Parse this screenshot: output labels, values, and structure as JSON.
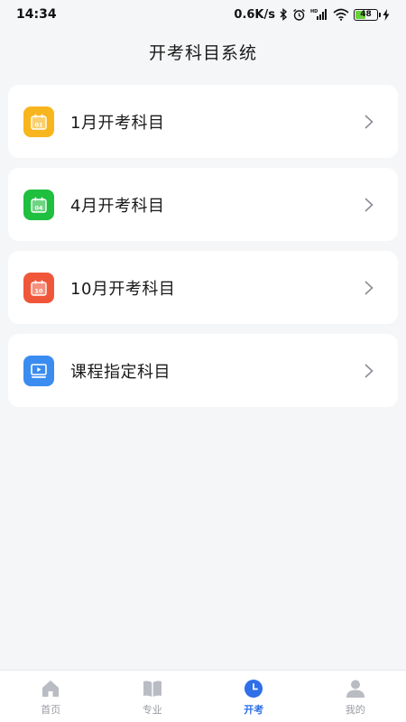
{
  "status_bar": {
    "time": "14:34",
    "speed": "0.6K/s",
    "battery": "48",
    "battery_level": 0.48,
    "icons": [
      "bluetooth-icon",
      "alarm-icon",
      "hd-signal-icon",
      "wifi-icon",
      "battery-icon",
      "charging-icon"
    ]
  },
  "header": {
    "title": "开考科目系统"
  },
  "cards": [
    {
      "label": "1月开考科目",
      "icon": "calendar-01-icon",
      "icon_text": "01",
      "color": "#f7b51e"
    },
    {
      "label": "4月开考科目",
      "icon": "calendar-04-icon",
      "icon_text": "04",
      "color": "#1fbf3f"
    },
    {
      "label": "10月开考科目",
      "icon": "calendar-10-icon",
      "icon_text": "10",
      "color": "#f0573a"
    },
    {
      "label": "课程指定科目",
      "icon": "video-play-icon",
      "icon_text": "",
      "color": "#3b8cf0"
    }
  ],
  "tab_bar": {
    "tabs": [
      {
        "label": "首页",
        "icon": "home-icon",
        "active": false
      },
      {
        "label": "专业",
        "icon": "book-icon",
        "active": false
      },
      {
        "label": "开考",
        "icon": "clock-icon",
        "active": true
      },
      {
        "label": "我的",
        "icon": "user-icon",
        "active": false
      }
    ],
    "active_color": "#2f6fe8",
    "inactive_color": "#b9bcc3"
  }
}
